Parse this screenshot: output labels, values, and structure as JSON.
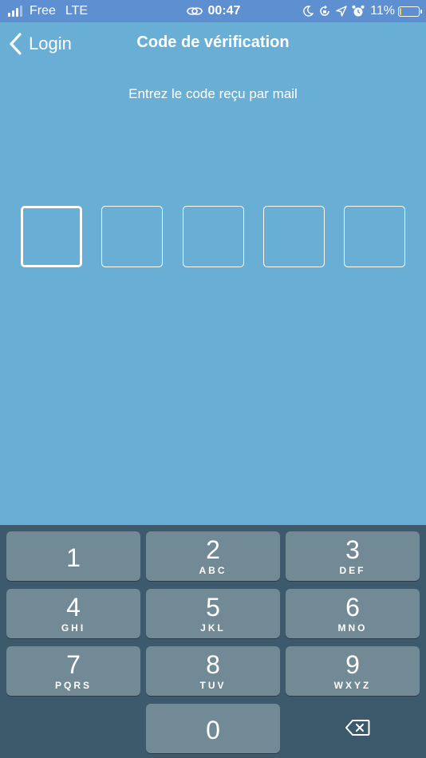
{
  "status_bar": {
    "carrier": "Free",
    "network": "LTE",
    "time": "00:47",
    "battery_percent": "11%",
    "battery_level": 0.11,
    "icons": [
      "signal-icon",
      "link-icon",
      "moon-icon",
      "rotation-lock-icon",
      "location-icon",
      "alarm-icon",
      "battery-icon"
    ]
  },
  "nav": {
    "back_label": "Login",
    "title": "Code de vérification"
  },
  "instruction": "Entrez le code reçu par mail",
  "code": {
    "length": 5,
    "values": [
      "",
      "",
      "",
      "",
      ""
    ],
    "active_index": 0
  },
  "keyboard": {
    "keys": [
      {
        "digit": "1",
        "letters": ""
      },
      {
        "digit": "2",
        "letters": "ABC"
      },
      {
        "digit": "3",
        "letters": "DEF"
      },
      {
        "digit": "4",
        "letters": "GHI"
      },
      {
        "digit": "5",
        "letters": "JKL"
      },
      {
        "digit": "6",
        "letters": "MNO"
      },
      {
        "digit": "7",
        "letters": "PQRS"
      },
      {
        "digit": "8",
        "letters": "TUV"
      },
      {
        "digit": "9",
        "letters": "WXYZ"
      },
      {
        "digit": "0",
        "letters": ""
      }
    ],
    "delete_icon": "backspace-icon"
  },
  "colors": {
    "background": "#69AED5",
    "status_bar": "#5E8FD0",
    "keyboard_bg": "#3C5A6C",
    "key_bg": "#728A96",
    "battery_fill": "#F7CE46"
  }
}
